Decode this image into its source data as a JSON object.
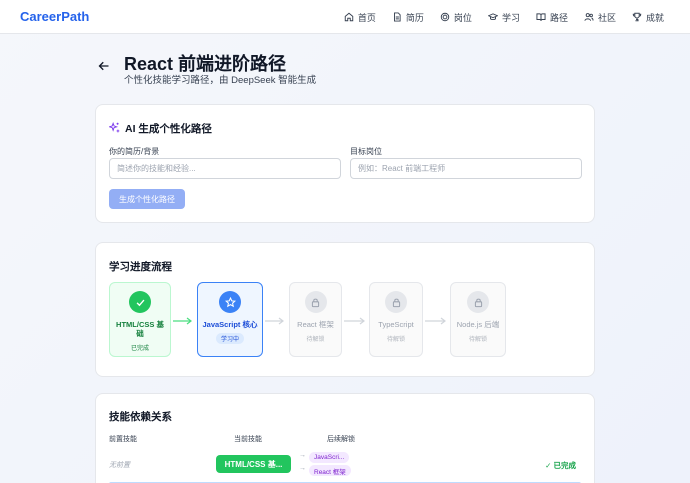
{
  "nav": {
    "logo": "CareerPath",
    "items": [
      {
        "label": "首页",
        "icon": "home-icon"
      },
      {
        "label": "简历",
        "icon": "document-icon"
      },
      {
        "label": "岗位",
        "icon": "target-icon"
      },
      {
        "label": "学习",
        "icon": "graduation-cap-icon"
      },
      {
        "label": "路径",
        "icon": "book-icon"
      },
      {
        "label": "社区",
        "icon": "users-icon"
      },
      {
        "label": "成就",
        "icon": "trophy-icon"
      }
    ]
  },
  "header": {
    "title": "React 前端进阶路径",
    "subtitle": "个性化技能学习路径，由 DeepSeek 智能生成"
  },
  "ai_card": {
    "title": "AI 生成个性化路径",
    "resume_label": "你的简历/背景",
    "resume_placeholder": "简述你的技能和经验...",
    "target_label": "目标岗位",
    "target_placeholder": "例如：React 前端工程师",
    "generate_label": "生成个性化路径"
  },
  "progress": {
    "title": "学习进度流程",
    "nodes": [
      {
        "label": "HTML/CSS 基础",
        "status": "已完成",
        "state": "done"
      },
      {
        "label": "JavaScript 核心",
        "status": "学习中",
        "state": "current"
      },
      {
        "label": "React 框架",
        "status": "待解锁",
        "state": "locked"
      },
      {
        "label": "TypeScript",
        "status": "待解锁",
        "state": "locked"
      },
      {
        "label": "Node.js 后端",
        "status": "待解锁",
        "state": "locked"
      }
    ]
  },
  "deps": {
    "title": "技能依赖关系",
    "col_prereq": "前置技能",
    "col_current": "当前技能",
    "col_unlock": "后续解锁",
    "row": {
      "prereq": "无前置",
      "current": "HTML/CSS 基...",
      "unlocks": [
        "JavaScri...",
        "React 框架"
      ],
      "status": "✓ 已完成"
    }
  },
  "colors": {
    "brand": "#2563eb",
    "done": "#22c55e",
    "current": "#3b82f6",
    "locked": "#e5e7eb",
    "pill": "#f3e8ff"
  }
}
